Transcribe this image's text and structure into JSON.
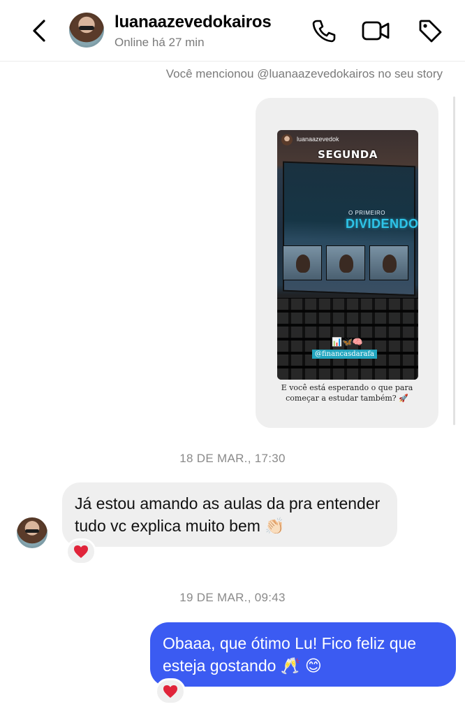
{
  "header": {
    "username": "luanaazevedokairos",
    "status": "Online há 27 min",
    "icons": [
      "back-chevron-icon",
      "phone-icon",
      "video-camera-icon",
      "tag-icon"
    ]
  },
  "mention_note": "Você mencionou @luanaazevedokairos no seu story",
  "story": {
    "author": "luanaazevedok",
    "title": "SEGUNDA",
    "overlay_small": "O PRIMEIRO",
    "overlay_big": "DIVIDENDO",
    "emojis": "📊🦋🧠",
    "tag": "@financasdarafa",
    "caption": "E você está esperando o que para começar a estudar também? 🚀"
  },
  "messages": [
    {
      "date": "18 DE MAR., 17:30",
      "direction": "incoming",
      "text": "Já estou amando as aulas  da pra entender tudo vc explica muito bem 👏🏻",
      "reaction": "❤️"
    },
    {
      "date": "19 DE MAR., 09:43",
      "direction": "outgoing",
      "text": "Obaaa, que ótimo Lu! Fico feliz que esteja gostando 🥂 😊",
      "reaction": "❤️"
    }
  ],
  "colors": {
    "outgoing_bubble": "#3b5bf2",
    "incoming_bubble": "#efefef",
    "reaction_heart": "#e0243a",
    "secondary_text": "#7a7a7a"
  }
}
